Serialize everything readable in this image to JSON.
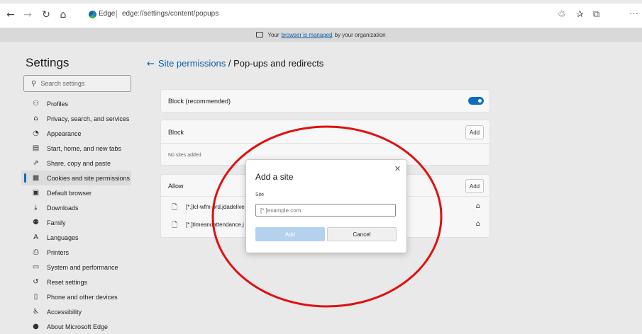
{
  "browser": {
    "edge_label": "Edge",
    "url_separator": "|",
    "url": "edge://settings/content/popups",
    "toolbar_icons": [
      "back-icon",
      "forward-icon",
      "refresh-icon",
      "home-icon",
      "tracking-icon",
      "favorites-icon",
      "collections-icon",
      "more-icon"
    ],
    "icon_glyphs": {
      "back": "←",
      "forward": "→",
      "refresh": "↻",
      "home": "⌂",
      "tracking": "♲",
      "favorites": "✰",
      "collections": "⧉",
      "more": "···"
    }
  },
  "banner": {
    "prefix": "Your",
    "link": "browser is managed",
    "suffix": "by your organization"
  },
  "sidebar": {
    "title": "Settings",
    "search_placeholder": "Search settings",
    "search_icon_glyph": "⚲",
    "items": [
      {
        "label": "Profiles",
        "icon": "profile-icon",
        "glyph": "⚇",
        "active": false
      },
      {
        "label": "Privacy, search, and services",
        "icon": "lock-icon",
        "glyph": "⌂",
        "active": false
      },
      {
        "label": "Appearance",
        "icon": "appearance-icon",
        "glyph": "◔",
        "active": false
      },
      {
        "label": "Start, home, and new tabs",
        "icon": "start-icon",
        "glyph": "▤",
        "active": false
      },
      {
        "label": "Share, copy and paste",
        "icon": "share-icon",
        "glyph": "⇗",
        "active": false
      },
      {
        "label": "Cookies and site permissions",
        "icon": "cookies-icon",
        "glyph": "▦",
        "active": true
      },
      {
        "label": "Default browser",
        "icon": "default-browser-icon",
        "glyph": "▣",
        "active": false
      },
      {
        "label": "Downloads",
        "icon": "download-icon",
        "glyph": "⤓",
        "active": false
      },
      {
        "label": "Family",
        "icon": "family-icon",
        "glyph": "⚉",
        "active": false
      },
      {
        "label": "Languages",
        "icon": "languages-icon",
        "glyph": "A",
        "active": false
      },
      {
        "label": "Printers",
        "icon": "printer-icon",
        "glyph": "⎙",
        "active": false
      },
      {
        "label": "System and performance",
        "icon": "system-icon",
        "glyph": "▭",
        "active": false
      },
      {
        "label": "Reset settings",
        "icon": "reset-icon",
        "glyph": "↺",
        "active": false
      },
      {
        "label": "Phone and other devices",
        "icon": "phone-icon",
        "glyph": "▯",
        "active": false
      },
      {
        "label": "Accessibility",
        "icon": "accessibility-icon",
        "glyph": "♿",
        "active": false
      },
      {
        "label": "About Microsoft Edge",
        "icon": "edge-icon",
        "glyph": "●",
        "active": false
      }
    ]
  },
  "main": {
    "back_glyph": "←",
    "breadcrumb": "Site permissions",
    "title_separator": " / ",
    "title": "Pop-ups and redirects",
    "block_recommended_label": "Block (recommended)",
    "block_recommended_on": true,
    "block": {
      "label": "Block",
      "add_label": "Add",
      "empty_text": "No sites added"
    },
    "allow": {
      "label": "Allow",
      "add_label": "Add",
      "doc_glyph": "🗋",
      "more_glyph": "⌂",
      "sites": [
        "[*.]lcl-wfm-prd.jdadelive",
        "[*.]timeandattendance.j"
      ]
    }
  },
  "dialog": {
    "title": "Add a site",
    "close_glyph": "✕",
    "site_label": "Site",
    "input_placeholder": "[*.]example.com",
    "add_label": "Add",
    "cancel_label": "Cancel"
  },
  "colors": {
    "accent": "#0f6cbd",
    "highlight_ellipse": "#e01010",
    "disabled_button": "#b4d2ee"
  }
}
